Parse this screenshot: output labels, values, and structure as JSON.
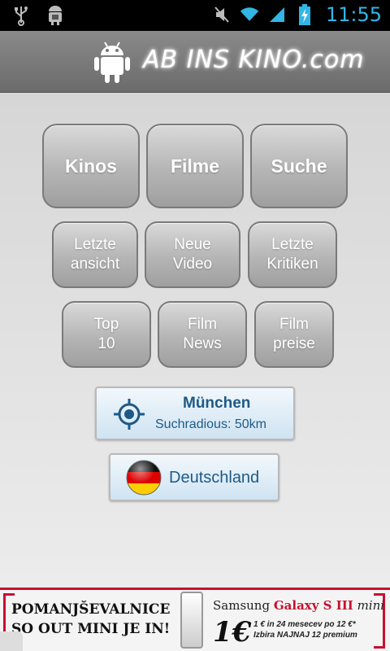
{
  "status_bar": {
    "time": "11:55",
    "icons": [
      "usb-icon",
      "android-debug-icon",
      "mute-icon",
      "wifi-icon",
      "signal-icon",
      "battery-charging-icon"
    ]
  },
  "header": {
    "logo_text": "AB INS KINO.com"
  },
  "main_buttons": {
    "kinos": "Kinos",
    "filme": "Filme",
    "suche": "Suche"
  },
  "secondary_buttons": {
    "letzte_ansicht": "Letzte\nansicht",
    "neue_video": "Neue\nVideo",
    "letzte_kritiken": "Letzte\nKritiken",
    "top10": "Top\n10",
    "film_news": "Film\nNews",
    "film_preise": "Film\npreise"
  },
  "location": {
    "city": "München",
    "radius": "Suchradious: 50km"
  },
  "country": {
    "label": "Deutschland"
  },
  "ad": {
    "left_line1": "POMANJŠEVALNICE",
    "left_line2": "SO OUT MINI JE IN!",
    "brand": "Samsung",
    "model": "Galaxy S III",
    "model_suffix": "mini",
    "price": "1€",
    "fine_line1": "1 € in 24 mesecev po 12 €*",
    "fine_line2": "Izbira NAJNAJ 12 premium"
  },
  "colors": {
    "status_accent": "#33b5e5",
    "header_bg": "#7a7a7a",
    "button_text": "#ffffff",
    "blue_text": "#1e5a86",
    "ad_red": "#c8102e"
  }
}
